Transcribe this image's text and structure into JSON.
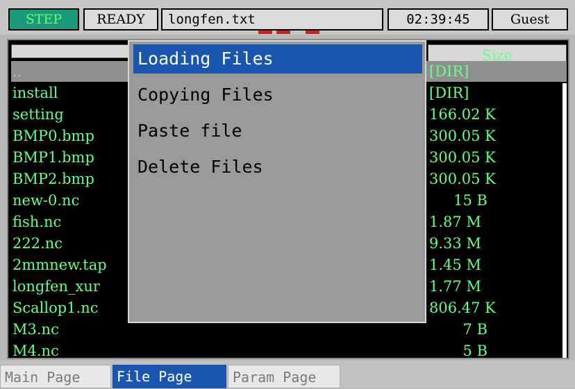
{
  "status": {
    "mode": "STEP",
    "state": "READY",
    "filename": "longfen.txt",
    "time": "02:39:45",
    "user": "Guest"
  },
  "headers": {
    "name": "",
    "size": "Size"
  },
  "files": [
    {
      "name": "..",
      "size": "[DIR]"
    },
    {
      "name": "install",
      "size": "[DIR]"
    },
    {
      "name": "setting",
      "size": "166.02 K"
    },
    {
      "name": "BMP0.bmp",
      "size": "300.05 K"
    },
    {
      "name": "BMP1.bmp",
      "size": "300.05 K"
    },
    {
      "name": "BMP2.bmp",
      "size": "300.05 K"
    },
    {
      "name": "new-0.nc",
      "size": "15 B"
    },
    {
      "name": "fish.nc",
      "size": "1.87 M"
    },
    {
      "name": "222.nc",
      "size": "9.33 M"
    },
    {
      "name": "2mmnew.tap",
      "size": "1.45 M"
    },
    {
      "name": "longfen_xur",
      "size": "1.77 M"
    },
    {
      "name": "Scallop1.nc",
      "size": "806.47 K"
    },
    {
      "name": "M3.nc",
      "size": "7 B"
    },
    {
      "name": "M4.nc",
      "size": "5 B"
    }
  ],
  "menu": {
    "items": [
      "Loading Files",
      "Copying Files",
      "Paste file",
      "Delete Files"
    ],
    "active_index": 0
  },
  "tabs": [
    "Main Page",
    "File Page",
    "Param Page"
  ],
  "active_tab": "File Page"
}
